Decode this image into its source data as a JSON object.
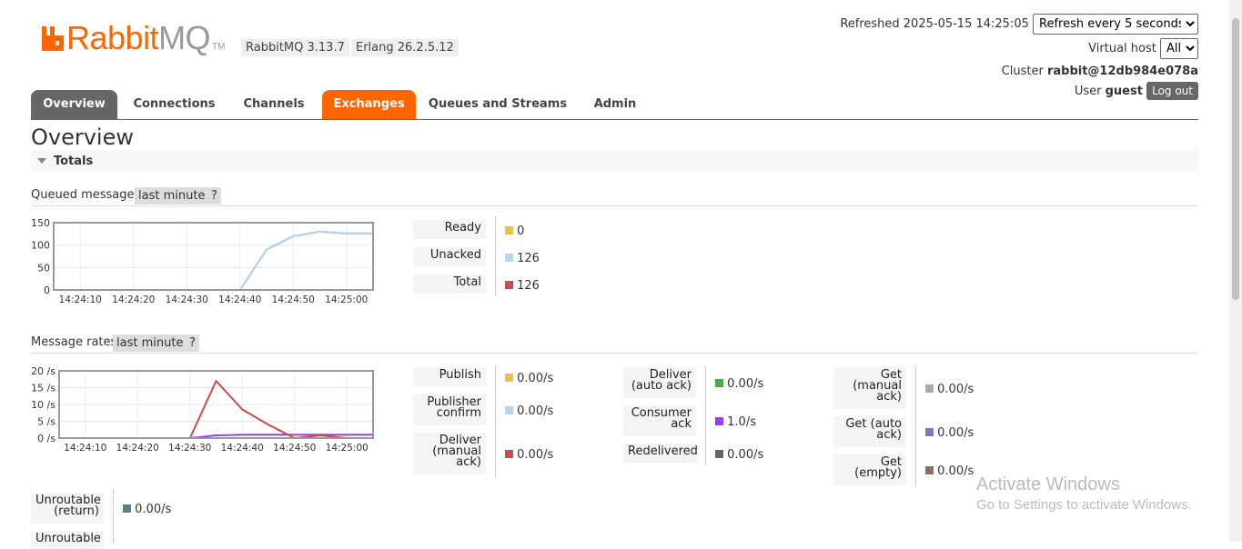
{
  "header": {
    "brand_main": "Rabbit",
    "brand_mq": "MQ",
    "trademark": "TM",
    "rabbitmq_version": "RabbitMQ 3.13.7",
    "erlang_version": "Erlang 26.2.5.12",
    "refreshed_label": "Refreshed 2025-05-15 14:25:05",
    "refresh_option": "Refresh every 5 seconds",
    "vhost_label": "Virtual host",
    "vhost_option": "All",
    "cluster_label": "Cluster",
    "cluster_name": "rabbit@12db984e078a",
    "user_label": "User",
    "user_name": "guest",
    "logout_label": "Log out"
  },
  "tabs": [
    {
      "label": "Overview",
      "state": "selected"
    },
    {
      "label": "Connections",
      "state": "normal"
    },
    {
      "label": "Channels",
      "state": "normal"
    },
    {
      "label": "Exchanges",
      "state": "highlighted"
    },
    {
      "label": "Queues and Streams",
      "state": "normal"
    },
    {
      "label": "Admin",
      "state": "normal"
    }
  ],
  "page_title": "Overview",
  "section_title": "Totals",
  "queued": {
    "title": "Queued messages",
    "range": "last minute",
    "help": "?",
    "legend": [
      {
        "label": "Ready",
        "value": "0",
        "color": "#edc240"
      },
      {
        "label": "Unacked",
        "value": "126",
        "color": "#afd8f8"
      },
      {
        "label": "Total",
        "value": "126",
        "color": "#cb4b4b"
      }
    ]
  },
  "rates": {
    "title": "Message rates",
    "range": "last minute",
    "help": "?",
    "col1": [
      {
        "label": [
          "Publish"
        ],
        "value": "0.00/s",
        "color": "#edc240"
      },
      {
        "label": [
          "Publisher",
          "confirm"
        ],
        "value": "0.00/s",
        "color": "#afd8f8"
      },
      {
        "label": [
          "Deliver",
          "(manual",
          "ack)"
        ],
        "value": "0.00/s",
        "color": "#cb4b4b"
      }
    ],
    "col2": [
      {
        "label": [
          "Deliver",
          "(auto ack)"
        ],
        "value": "0.00/s",
        "color": "#4da74d"
      },
      {
        "label": [
          "Consumer",
          "ack"
        ],
        "value": "1.0/s",
        "color": "#9440ed"
      },
      {
        "label": [
          "Redelivered"
        ],
        "value": "0.00/s",
        "color": "#666666"
      }
    ],
    "col3": [
      {
        "label": [
          "Get",
          "(manual",
          "ack)"
        ],
        "value": "0.00/s",
        "color": "#aaaaaa"
      },
      {
        "label": [
          "Get (auto",
          "ack)"
        ],
        "value": "0.00/s",
        "color": "#7c79c3"
      },
      {
        "label": [
          "Get",
          "(empty)"
        ],
        "value": "0.00/s",
        "color": "#8d6e63"
      }
    ],
    "col0": [
      {
        "label": [
          "Unroutable",
          "(return)"
        ],
        "value": "0.00/s",
        "color": "#607d8b"
      },
      {
        "label": [
          "Unroutable"
        ],
        "value": "",
        "color": "#607d8b"
      }
    ]
  },
  "watermark": {
    "line1": "Activate Windows",
    "line2": "Go to Settings to activate Windows."
  },
  "chart_data": [
    {
      "type": "line",
      "title": "Queued messages",
      "x": [
        "14:24:05",
        "14:24:10",
        "14:24:15",
        "14:24:20",
        "14:24:25",
        "14:24:30",
        "14:24:35",
        "14:24:40",
        "14:24:45",
        "14:24:50",
        "14:24:55",
        "14:25:00",
        "14:25:05"
      ],
      "xticks": [
        "14:24:10",
        "14:24:20",
        "14:24:30",
        "14:24:40",
        "14:24:50",
        "14:25:00"
      ],
      "yticks": [
        "150",
        "100",
        "50",
        "0"
      ],
      "ylim": [
        0,
        150
      ],
      "grid": true,
      "series": [
        {
          "name": "Ready",
          "color": "#edc240",
          "values": [
            0,
            0,
            0,
            0,
            0,
            0,
            0,
            0,
            0,
            0,
            0,
            0,
            0
          ]
        },
        {
          "name": "Unacked",
          "color": "#afd8f8",
          "values": [
            0,
            0,
            0,
            0,
            0,
            0,
            0,
            0,
            90,
            120,
            130,
            126,
            126
          ]
        },
        {
          "name": "Total",
          "color": "#cb4b4b",
          "values": [
            0,
            0,
            0,
            0,
            0,
            0,
            0,
            0,
            90,
            120,
            130,
            126,
            126
          ]
        }
      ]
    },
    {
      "type": "line",
      "title": "Message rates",
      "x": [
        "14:24:05",
        "14:24:10",
        "14:24:15",
        "14:24:20",
        "14:24:25",
        "14:24:30",
        "14:24:35",
        "14:24:40",
        "14:24:45",
        "14:24:50",
        "14:24:55",
        "14:25:00",
        "14:25:05"
      ],
      "xticks": [
        "14:24:10",
        "14:24:20",
        "14:24:30",
        "14:24:40",
        "14:24:50",
        "14:25:00"
      ],
      "yticks": [
        "20 /s",
        "15 /s",
        "10 /s",
        "5 /s",
        "0 /s"
      ],
      "ylim": [
        0,
        20
      ],
      "grid": true,
      "series": [
        {
          "name": "Deliver (manual ack)",
          "color": "#cb4b4b",
          "values": [
            0,
            0,
            0,
            0,
            0,
            0,
            17,
            8.5,
            4,
            0,
            0.8,
            0,
            0
          ]
        },
        {
          "name": "Consumer ack",
          "color": "#9440ed",
          "values": [
            0,
            0,
            0,
            0,
            0,
            0,
            0.8,
            1,
            1,
            1,
            1,
            1,
            1
          ]
        },
        {
          "name": "Publish",
          "color": "#edc240",
          "values": [
            0,
            0,
            0,
            0,
            0,
            0,
            0,
            0,
            0,
            0,
            0,
            0,
            0
          ]
        }
      ]
    }
  ]
}
